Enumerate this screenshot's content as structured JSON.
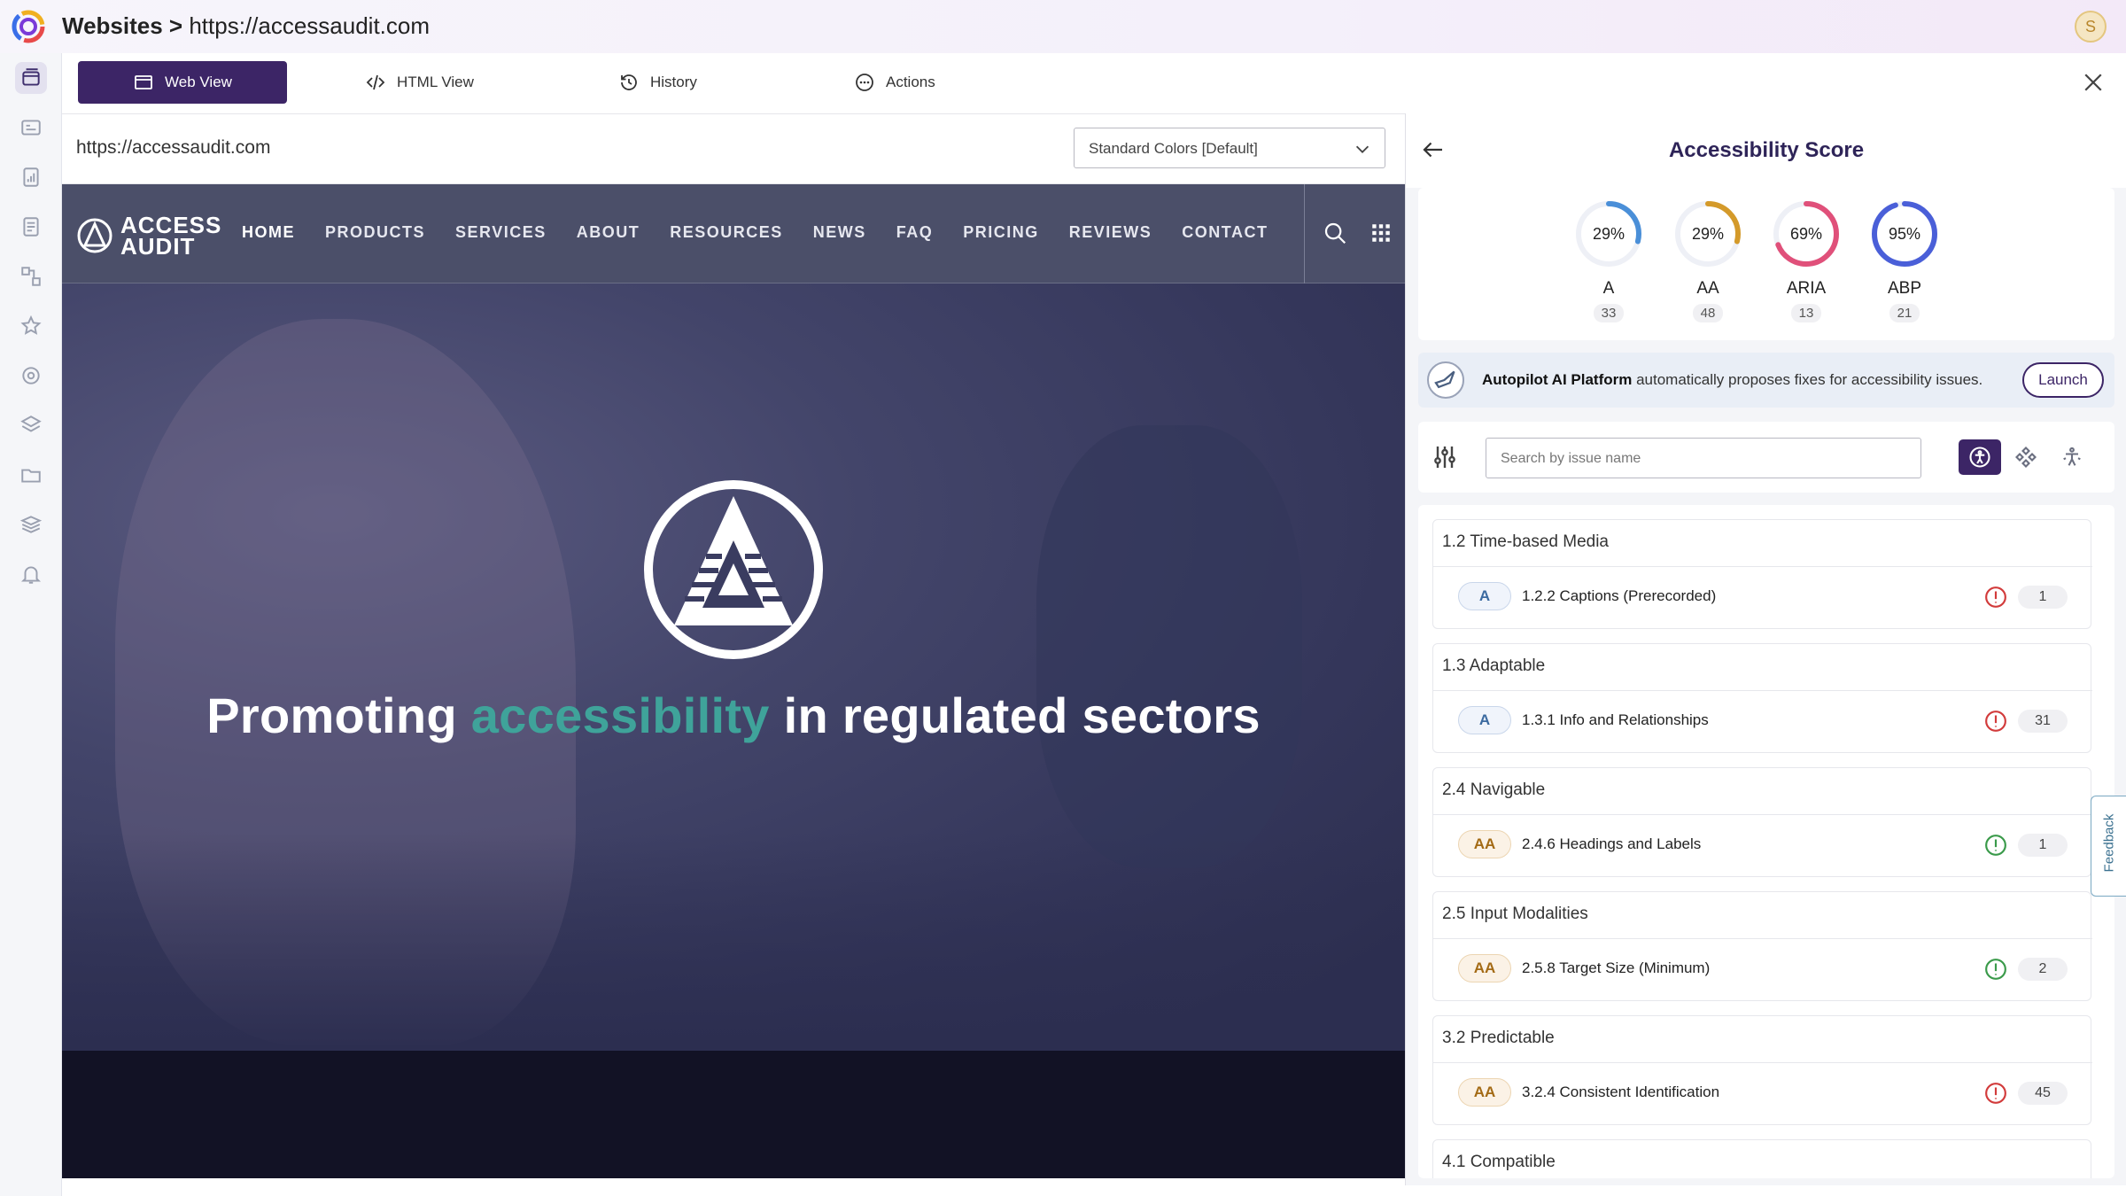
{
  "header": {
    "breadcrumb_root": "Websites",
    "breadcrumb_sep": ">",
    "breadcrumb_url": "https://accessaudit.com",
    "avatar_initial": "S"
  },
  "tabs": [
    {
      "label": "Web View",
      "icon": "browser-window-icon",
      "active": true
    },
    {
      "label": "HTML View",
      "icon": "code-icon",
      "active": false
    },
    {
      "label": "History",
      "icon": "history-icon",
      "active": false
    },
    {
      "label": "Actions",
      "icon": "more-dots-icon",
      "active": false
    }
  ],
  "urlbar": {
    "url": "https://accessaudit.com",
    "color_mode": "Standard Colors [Default]"
  },
  "site": {
    "brand_line1": "ACCESS",
    "brand_line2": "AUDIT",
    "nav": [
      "HOME",
      "PRODUCTS",
      "SERVICES",
      "ABOUT",
      "RESOURCES",
      "NEWS",
      "FAQ",
      "PRICING",
      "REVIEWS",
      "CONTACT"
    ],
    "hero_pre": "Promoting ",
    "hero_accent": "accessibility",
    "hero_post": " in regulated sectors"
  },
  "panel": {
    "title": "Accessibility Score",
    "scores": [
      {
        "label": "A",
        "percent": 29,
        "percent_text": "29%",
        "count": "33",
        "color": "#4a8fd8"
      },
      {
        "label": "AA",
        "percent": 29,
        "percent_text": "29%",
        "count": "48",
        "color": "#d49a2a"
      },
      {
        "label": "ARIA",
        "percent": 69,
        "percent_text": "69%",
        "count": "13",
        "color": "#e0507a"
      },
      {
        "label": "ABP",
        "percent": 95,
        "percent_text": "95%",
        "count": "21",
        "color": "#4a5fd8"
      }
    ],
    "autopilot_bold": "Autopilot AI Platform",
    "autopilot_text": " automatically proposes fixes for accessibility issues.",
    "launch_label": "Launch",
    "search_placeholder": "Search by issue name",
    "groups": [
      {
        "title": "1.2 Time-based Media",
        "level": "A",
        "issue": "1.2.2 Captions (Prerecorded)",
        "severity": "error",
        "count": "1"
      },
      {
        "title": "1.3 Adaptable",
        "level": "A",
        "issue": "1.3.1 Info and Relationships",
        "severity": "error",
        "count": "31"
      },
      {
        "title": "2.4 Navigable",
        "level": "AA",
        "issue": "2.4.6 Headings and Labels",
        "severity": "warning",
        "count": "1"
      },
      {
        "title": "2.5 Input Modalities",
        "level": "AA",
        "issue": "2.5.8 Target Size (Minimum)",
        "severity": "warning",
        "count": "2"
      },
      {
        "title": "3.2 Predictable",
        "level": "AA",
        "issue": "3.2.4 Consistent Identification",
        "severity": "error",
        "count": "45"
      },
      {
        "title": "4.1 Compatible"
      }
    ],
    "feedback_label": "Feedback"
  },
  "colors": {
    "brand": "#3c2566",
    "accent": "#3fa39a",
    "error": "#d23b3b",
    "warning": "#3a9a4a"
  }
}
